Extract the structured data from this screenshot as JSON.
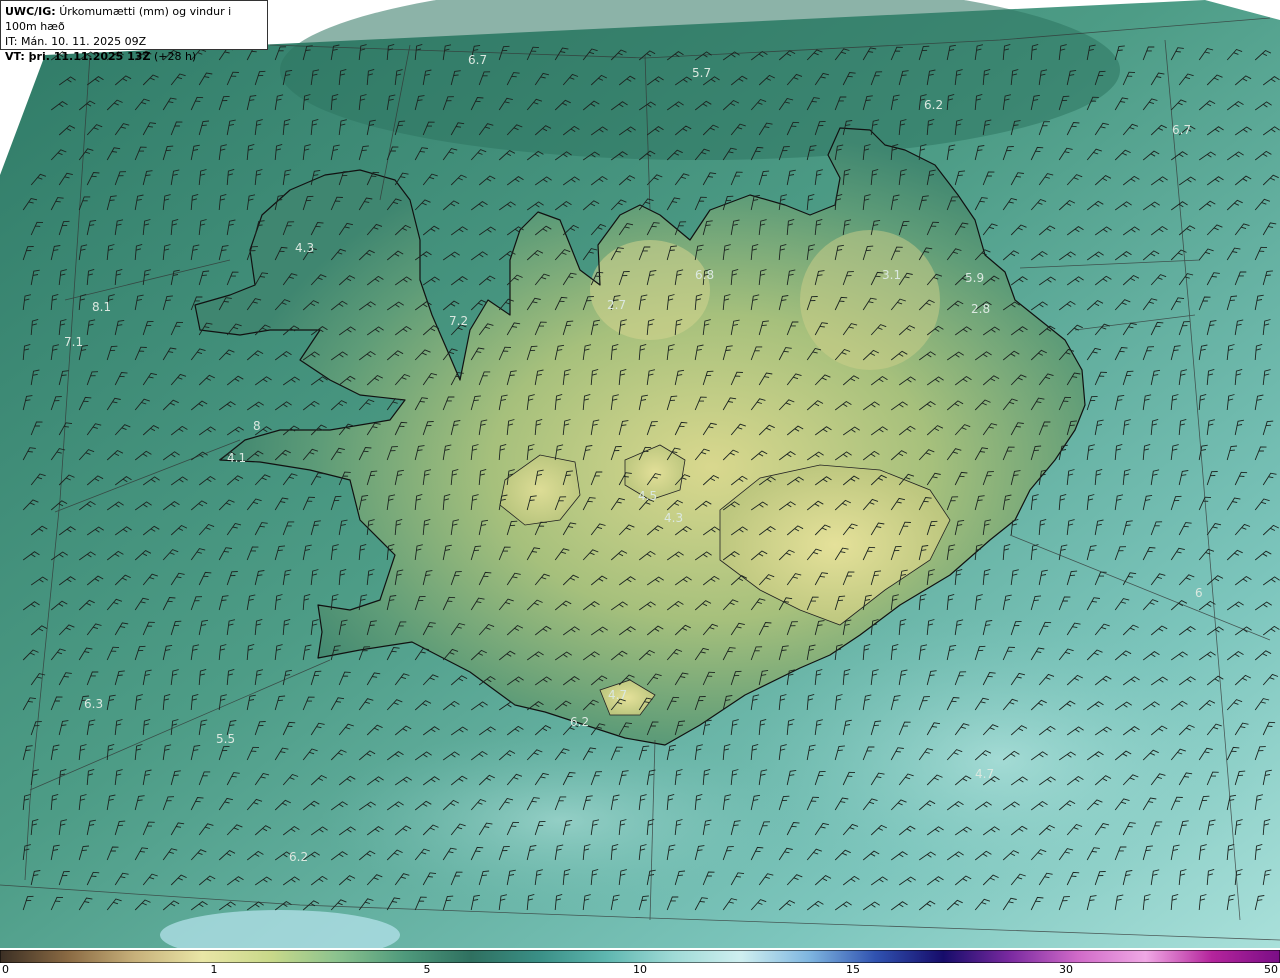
{
  "header": {
    "model_code": "UWC/IG:",
    "title": "Úrkomumætti (mm) og vindur i 100m hæð",
    "init_line": "IT: Mán. 10. 11. 2025 09Z",
    "valid_prefix": "VT: þri. 11.11.2025 13Z",
    "valid_offset": "(+28 h)"
  },
  "colorbar": {
    "tick_labels": [
      "0",
      "1",
      "5",
      "10",
      "15",
      "30",
      "50"
    ],
    "colors": [
      "#3b2f24",
      "#8a6a43",
      "#c7b07a",
      "#e9e6a6",
      "#c9d98a",
      "#8cc38e",
      "#4f9a7c",
      "#2f7060",
      "#3a8f86",
      "#5fb7b0",
      "#9fdad6",
      "#cfeff0",
      "#7fb6e0",
      "#3052b0",
      "#160c6a",
      "#7a2aa0",
      "#d06ac8",
      "#f0a8e4",
      "#b4249c",
      "#7a0e86"
    ]
  },
  "map": {
    "ocean_color": "#4b9a8a",
    "land_color_high": "#c9cf82",
    "land_color_low": "#3e8b74",
    "coastline_color": "#111111",
    "value_labels": [
      "6.7",
      "5.7",
      "6.2",
      "6.7",
      "4.3",
      "6.8",
      "3.1",
      "5.9",
      "2.8",
      "2.7",
      "7.2",
      "8.1",
      "7.1",
      "8",
      "4.1",
      "4.5",
      "4.3",
      "4.7",
      "6.3",
      "5.5",
      "6.2",
      "6.2",
      "4.7",
      "6"
    ]
  }
}
